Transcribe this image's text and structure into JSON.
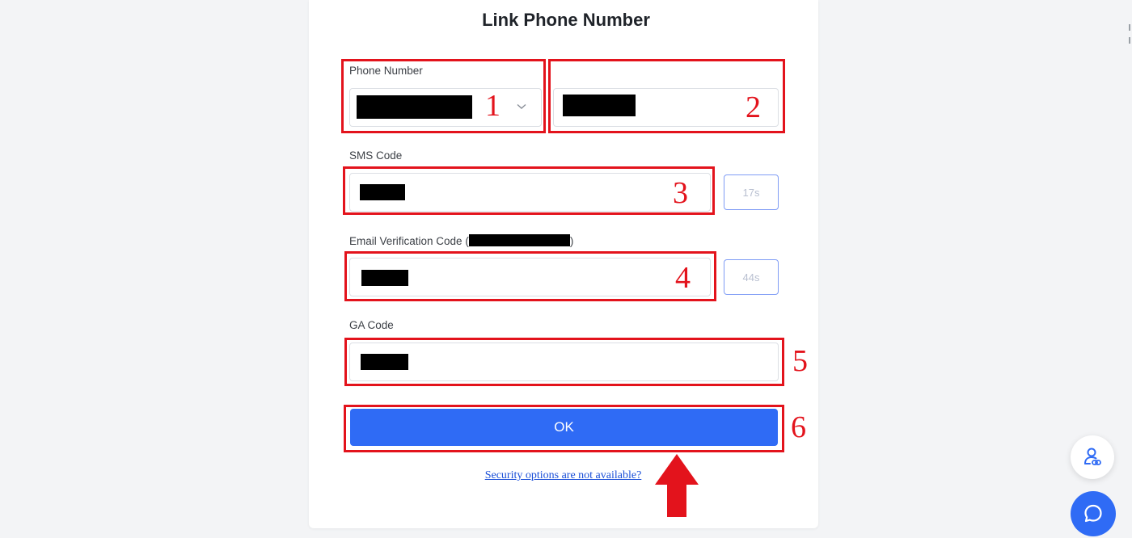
{
  "page": {
    "title": "Link Phone Number"
  },
  "form": {
    "phone_label": "Phone Number",
    "sms_label": "SMS Code",
    "sms_timer": "17s",
    "email_label": "Email Verification Code",
    "email_label_open": "(",
    "email_label_close": ")",
    "email_timer": "44s",
    "ga_label": "GA Code",
    "ok_label": "OK",
    "security_link": "Security options are not available?"
  },
  "annotations": [
    "1",
    "2",
    "3",
    "4",
    "5",
    "6"
  ],
  "icons": {
    "dropdown": "chevron-down-icon",
    "account": "user-link-icon",
    "chat": "chat-bubble-icon"
  },
  "colors": {
    "annotation": "#e3131c",
    "primary": "#2f6bf5",
    "timer_border": "#7f9cf5"
  }
}
